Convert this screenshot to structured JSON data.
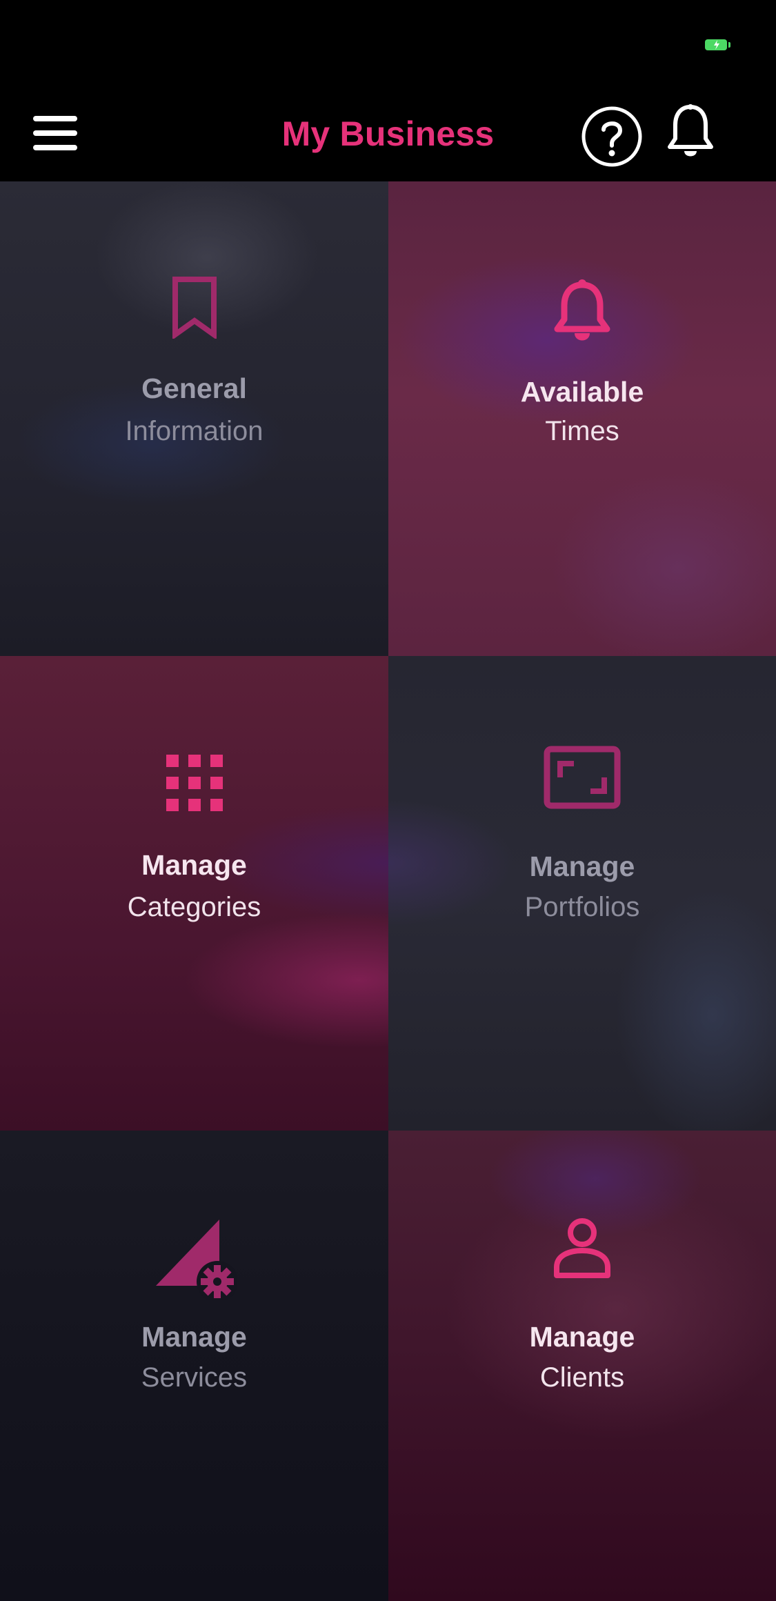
{
  "status_bar": {
    "battery_color": "#4cd964"
  },
  "header": {
    "title": "My Business",
    "menu_icon": "hamburger-menu-icon",
    "help_icon": "question-circle-icon",
    "notifications_icon": "bell-icon"
  },
  "colors": {
    "accent": "#e6327a",
    "accent_muted": "#a02a6a",
    "background": "#000000"
  },
  "tiles": [
    {
      "line1": "General",
      "line2": "Information",
      "icon": "bookmark-icon"
    },
    {
      "line1": "Available",
      "line2": "Times",
      "icon": "bell-icon"
    },
    {
      "line1": "Manage",
      "line2": "Categories",
      "icon": "grid-icon"
    },
    {
      "line1": "Manage",
      "line2": "Portfolios",
      "icon": "frame-icon"
    },
    {
      "line1": "Manage",
      "line2": "Services",
      "icon": "services-gear-icon"
    },
    {
      "line1": "Manage",
      "line2": "Clients",
      "icon": "user-icon"
    }
  ]
}
